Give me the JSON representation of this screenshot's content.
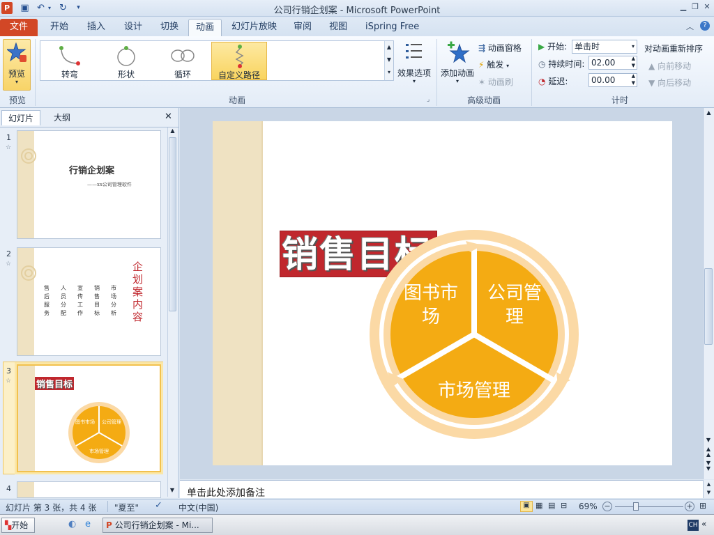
{
  "window": {
    "title": "公司行销企划案 - Microsoft PowerPoint",
    "qa_logo": "P"
  },
  "tabs": [
    "文件",
    "开始",
    "插入",
    "设计",
    "切换",
    "动画",
    "幻灯片放映",
    "审阅",
    "视图",
    "iSpring Free"
  ],
  "ribbon": {
    "preview": {
      "label": "预览",
      "group": "预览"
    },
    "gallery": [
      {
        "label": "转弯",
        "icon": "turn-path-icon"
      },
      {
        "label": "形状",
        "icon": "shape-path-icon"
      },
      {
        "label": "循环",
        "icon": "loop-path-icon"
      },
      {
        "label": "自定义路径",
        "icon": "custom-path-icon"
      }
    ],
    "effect_options": "效果选项",
    "animation_group": "动画",
    "add_animation": "添加动画",
    "animation_pane": "动画窗格",
    "trigger": "触发",
    "animation_painter": "动画刷",
    "advanced_group": "高级动画",
    "start_label": "开始:",
    "start_value": "单击时",
    "duration_label": "持续时间:",
    "duration_value": "02.00",
    "delay_label": "延迟:",
    "delay_value": "00.00",
    "timing_group": "计时",
    "reorder_title": "对动画重新排序",
    "move_earlier": "向前移动",
    "move_later": "向后移动"
  },
  "panel": {
    "tabs": [
      "幻灯片",
      "大纲"
    ],
    "close": "✕"
  },
  "thumbnails": {
    "s1": {
      "num": "1",
      "title": "行销企划案",
      "subtitle": "——xx公司管理软件"
    },
    "s2": {
      "num": "2",
      "cols": [
        "售后服务",
        "人员分配",
        "宣传工作",
        "销售目标",
        "市场分析"
      ],
      "vtitle": "企划案内容"
    },
    "s3": {
      "num": "3",
      "title": "销售目标",
      "seg1": "图书市场",
      "seg2": "公司管理",
      "seg3": "市场管理"
    },
    "s4": {
      "num": "4"
    }
  },
  "slide": {
    "title": "销售目标",
    "seg1_l1": "图书市",
    "seg1_l2": "场",
    "seg2_l1": "公司管",
    "seg2_l2": "理",
    "seg3": "市场管理"
  },
  "notes_placeholder": "单击此处添加备注",
  "status": {
    "slide_info": "幻灯片 第 3 张，共 4 张",
    "theme": "\"夏至\"",
    "language": "中文(中国)",
    "zoom": "69%"
  },
  "taskbar": {
    "start": "开始",
    "window_item": "公司行销企划案 - Mi...",
    "ime": "CH"
  },
  "colors": {
    "file_tab": "#d24726",
    "accent_orange": "#f4ab13",
    "ring": "#fbd9a5",
    "title_red": "#c0272d",
    "strip": "#efe2c2"
  }
}
